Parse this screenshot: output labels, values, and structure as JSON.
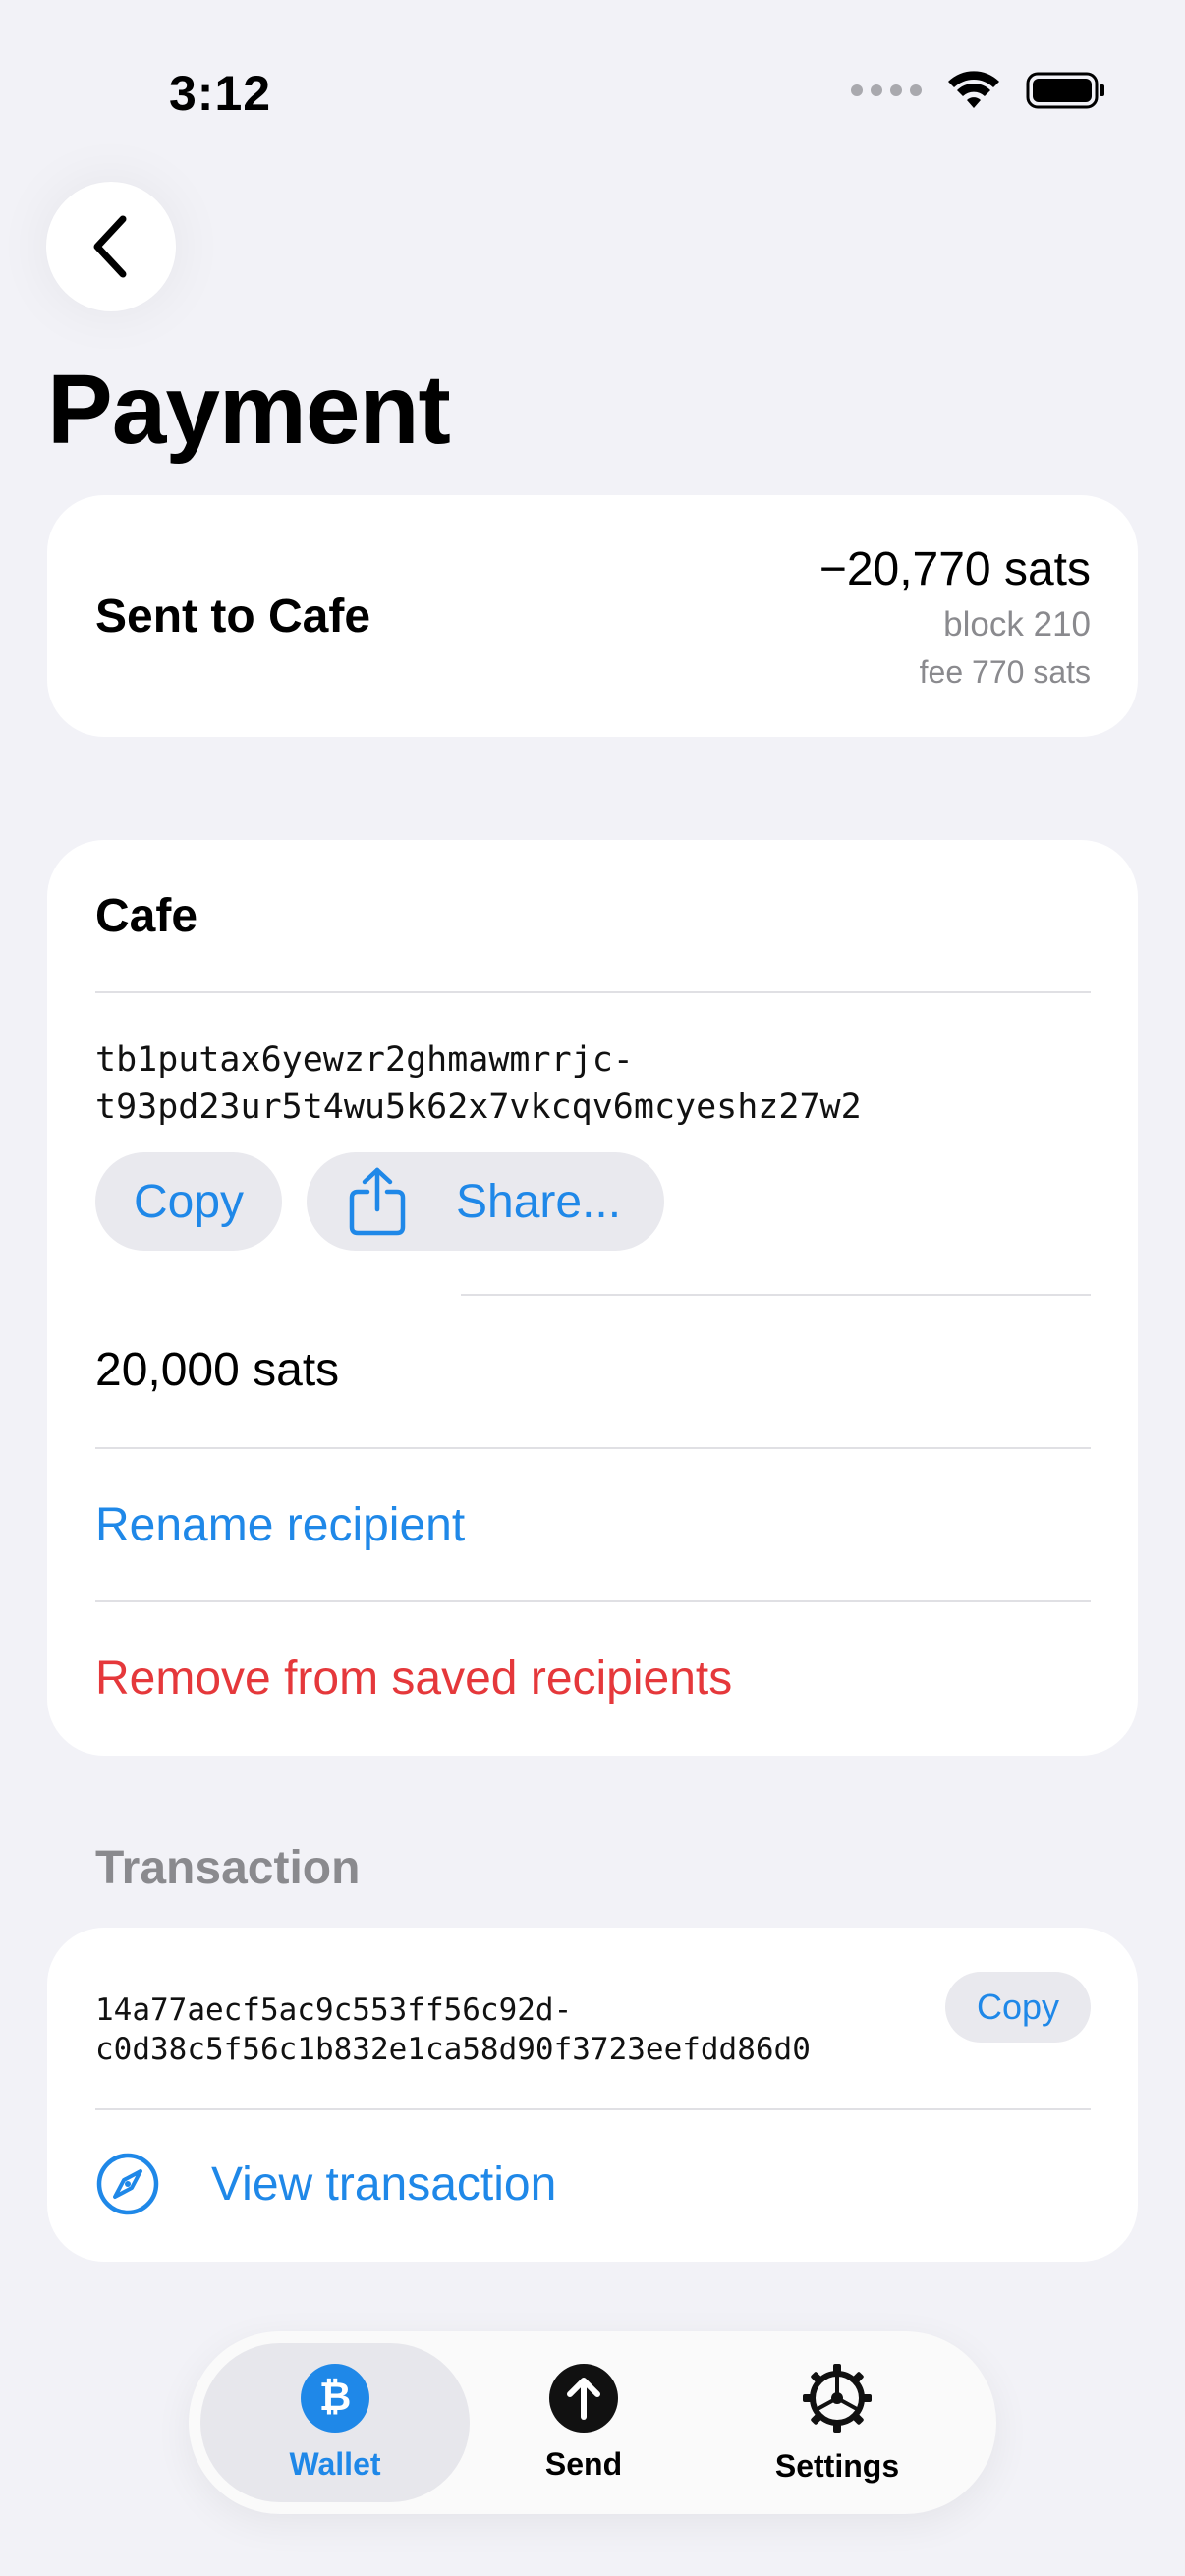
{
  "status_bar": {
    "time": "3:12"
  },
  "page": {
    "title": "Payment"
  },
  "summary": {
    "label": "Sent to Cafe",
    "amount": "−20,770 sats",
    "block": "block 210",
    "fee": "fee 770 sats"
  },
  "recipient": {
    "name": "Cafe",
    "address": "tb1putax6yewzr2ghmawmrrjc-\nt93pd23ur5t4wu5k62x7vkcqv6mcyeshz27w2",
    "copy_label": "Copy",
    "share_label": "Share...",
    "amount": "20,000 sats",
    "rename_label": "Rename recipient",
    "remove_label": "Remove from saved recipients"
  },
  "transaction": {
    "section_label": "Transaction",
    "txid": "14a77aecf5ac9c553ff56c92d-\nc0d38c5f56c1b832e1ca58d90f3723eefdd86d0",
    "copy_label": "Copy",
    "view_label": "View transaction"
  },
  "tabbar": {
    "items": [
      {
        "label": "Wallet",
        "icon": "bitcoin-icon",
        "active": true
      },
      {
        "label": "Send",
        "icon": "arrow-up-circle-icon",
        "active": false
      },
      {
        "label": "Settings",
        "icon": "gear-icon",
        "active": false
      }
    ]
  },
  "colors": {
    "accent": "#1f88e8",
    "destructive": "#e5383b",
    "background": "#f2f2f7"
  }
}
